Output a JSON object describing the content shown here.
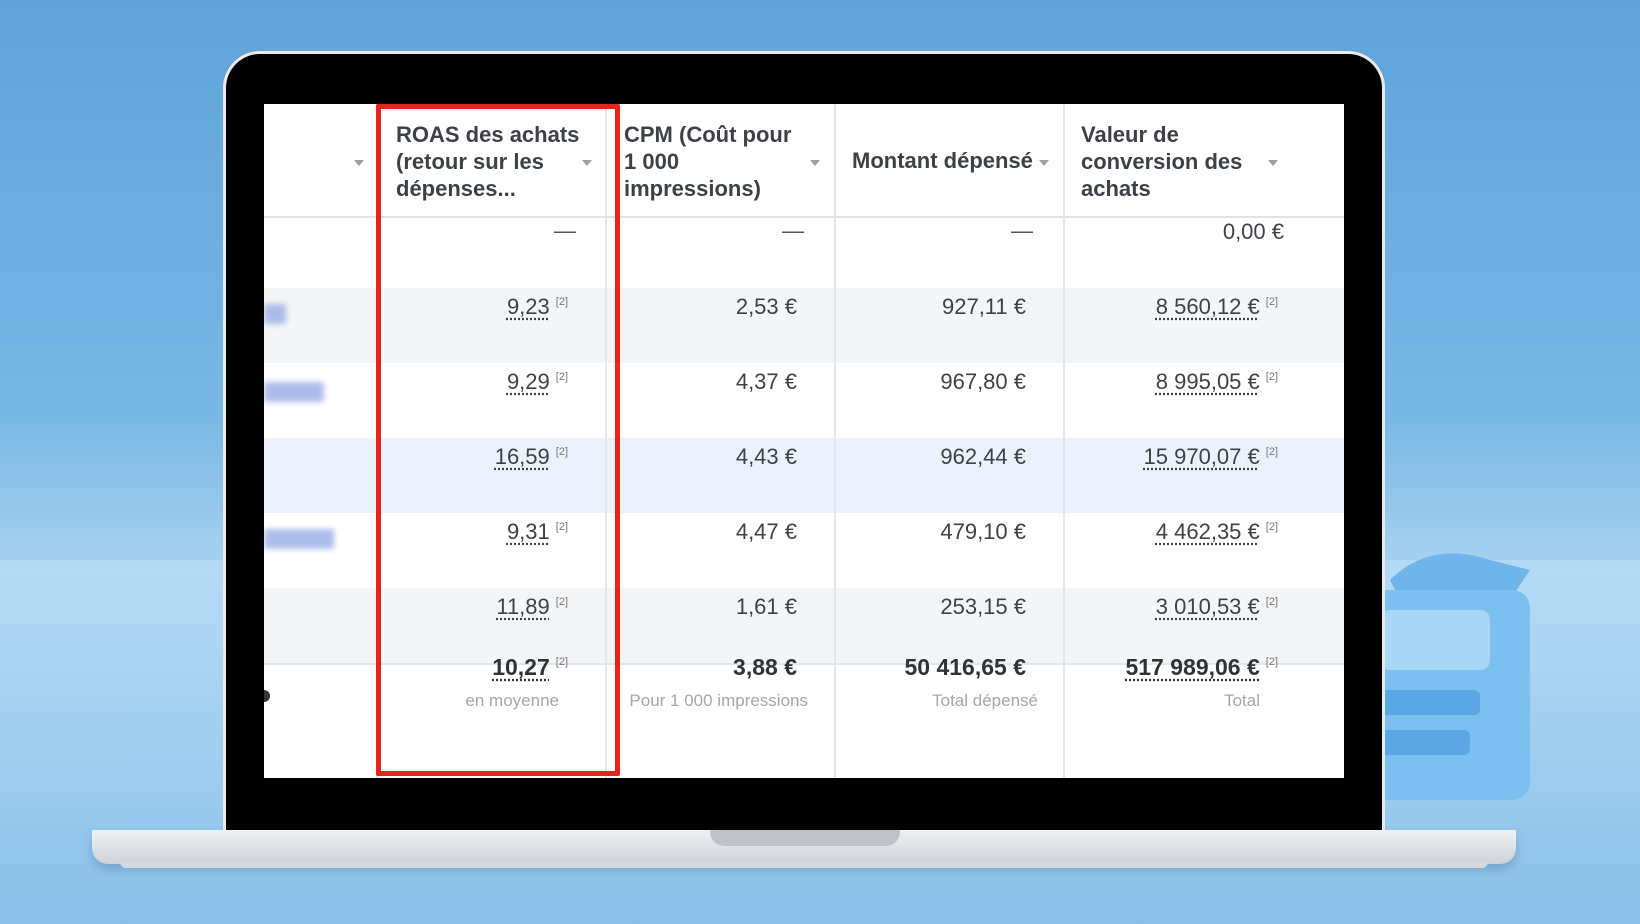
{
  "columns": [
    {
      "header": "ROAS des achats (retour sur les dépenses...",
      "lines": [
        "ROAS des achats",
        "(retour sur les",
        "dépenses..."
      ]
    },
    {
      "header": "CPM (Coût pour 1 000 impressions)",
      "lines": [
        "CPM (Coût pour",
        "1 000",
        "impressions)"
      ]
    },
    {
      "header": "Montant dépensé",
      "lines": [
        "Montant dépensé"
      ]
    },
    {
      "header": "Valeur de conversion des achats",
      "lines": [
        "Valeur de",
        "conversion des",
        "achats"
      ]
    }
  ],
  "first_row": {
    "roas": "—",
    "cpm": "—",
    "spent": "—",
    "conversion": "0,00 €"
  },
  "rows": [
    {
      "roas": "9,23",
      "cpm": "2,53 €",
      "spent": "927,11 €",
      "conversion": "8 560,12 €"
    },
    {
      "roas": "9,29",
      "cpm": "4,37 €",
      "spent": "967,80 €",
      "conversion": "8 995,05 €"
    },
    {
      "roas": "16,59",
      "cpm": "4,43 €",
      "spent": "962,44 €",
      "conversion": "15 970,07 €"
    },
    {
      "roas": "9,31",
      "cpm": "4,47 €",
      "spent": "479,10 €",
      "conversion": "4 462,35 €"
    },
    {
      "roas": "11,89",
      "cpm": "1,61 €",
      "spent": "253,15 €",
      "conversion": "3 010,53 €"
    }
  ],
  "attribution_marker": "[2]",
  "totals": {
    "roas": "10,27",
    "roas_sub": "en moyenne",
    "cpm": "3,88 €",
    "cpm_sub": "Pour 1 000 impressions",
    "spent": "50 416,65 €",
    "spent_sub": "Total dépensé",
    "conversion": "517 989,06 €",
    "conversion_sub": "Total"
  },
  "colors": {
    "highlight": "#e3261a",
    "row_alt": "#f4f5f7",
    "row_selected": "#ebf2fd"
  }
}
